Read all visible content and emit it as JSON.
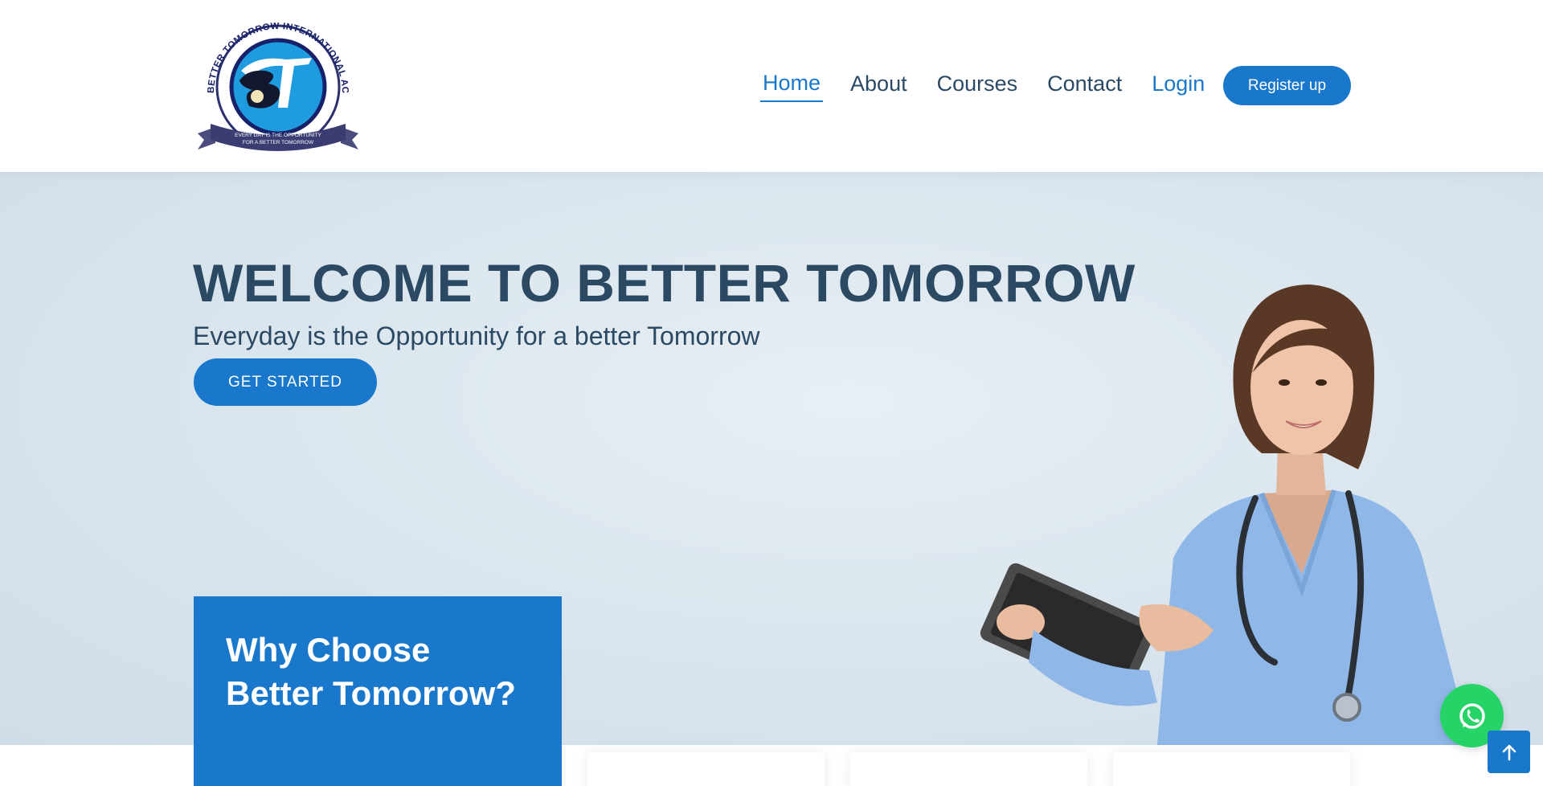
{
  "header": {
    "logo": {
      "ring_text": "BETTER TOMORROW INTERNATIONAL ACADEMY",
      "banner_line1": "EVERY DAY IS THE OPPORTUNITY",
      "banner_line2": "FOR A BETTER TOMORROW",
      "monogram": "BT"
    },
    "nav": [
      {
        "label": "Home",
        "active": true
      },
      {
        "label": "About",
        "active": false
      },
      {
        "label": "Courses",
        "active": false
      },
      {
        "label": "Contact",
        "active": false
      },
      {
        "label": "Login",
        "active": false
      }
    ],
    "register_label": "Register up"
  },
  "hero": {
    "title": "WELCOME TO BETTER TOMORROW",
    "subtitle": "Everyday is the Opportunity for a better Tomorrow",
    "cta_label": "GET STARTED"
  },
  "why": {
    "heading": "Why Choose Better Tomorrow?"
  },
  "floating": {
    "whatsapp_icon": "whatsapp-icon",
    "back_to_top_icon": "arrow-up-icon"
  },
  "colors": {
    "accent": "#1977cc",
    "heading": "#2c4964",
    "whatsapp": "#25d366"
  }
}
